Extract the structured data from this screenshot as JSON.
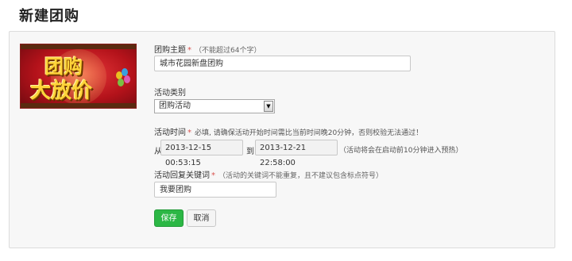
{
  "page": {
    "title": "新建团购"
  },
  "banner": {
    "line1": "团购",
    "line2": "大放价",
    "colors": {
      "background": "#c0161f",
      "text": "#ffd43a"
    }
  },
  "form": {
    "subject": {
      "label": "团购主题",
      "required_mark": "*",
      "hint": "（不能超过64个字）",
      "value": "城市花园新盘团购"
    },
    "category": {
      "label": "活动类别",
      "selected": "团购活动",
      "arrow_icon": "dropdown-arrow-icon"
    },
    "time": {
      "label": "活动时间",
      "required_mark": "*",
      "hint": "必填, 请确保活动开始时间需比当前时间晚20分钟，否则校验无法通过！",
      "from_label": "从",
      "start": "2013-12-15 00:53:15",
      "to_label": "到",
      "end": "2013-12-21 22:58:00",
      "note": "（活动将会在启动前10分钟进入预热）"
    },
    "keyword": {
      "label": "活动回复关键词",
      "required_mark": "*",
      "hint": "（活动的关键词不能重复，且不建议包含标点符号）",
      "value": "我要团购"
    }
  },
  "buttons": {
    "save": "保存",
    "cancel": "取消"
  },
  "colors": {
    "save_button": "#2cb745",
    "required": "#d9534f"
  }
}
